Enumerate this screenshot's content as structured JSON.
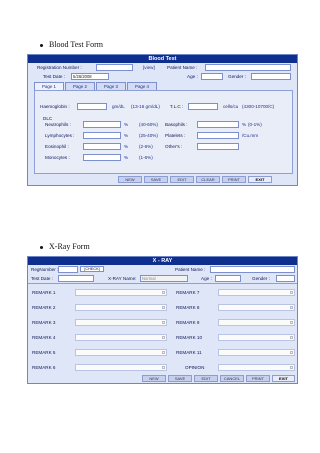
{
  "blood": {
    "heading": "Blood Test Form",
    "title": "Blood Test",
    "registration_label": "Registration Number :",
    "registration_value": "",
    "regno_button": "[view]",
    "patient_name_label": "Patient Name :",
    "patient_name_value": "",
    "test_date_label": "Test Date :",
    "test_date_value": "5/26/2008",
    "age_label": "Age :",
    "gender_label": "Gender :",
    "tabs": [
      "Page 1",
      "Page 2",
      "Page 3",
      "Page 4"
    ],
    "haemoglobin_label": "Haemoglobin :",
    "haemoglobin_unit": "gm/dL",
    "haemoglobin_range": "(13-16 gm/dL)",
    "tlc_label": "T.L.C :",
    "tlc_unit": "cells/cu",
    "tlc_range": "(4300-10700/C)",
    "dlc_label": "DLC",
    "neutrophils_label": "Neutrophils :",
    "neutrophils_unit": "%",
    "neutrophils_range": "(40-60%)",
    "lymphocytes_label": "Lymphocytes :",
    "lymphocytes_unit": "%",
    "lymphocytes_range": "(25-40%)",
    "eosinophil_label": "Eosinophil :",
    "eosinophil_unit": "%",
    "eosinophil_range": "(2-6%)",
    "monocytes_label": "Monocytes :",
    "monocytes_unit": "%",
    "monocytes_range": "(1-6%)",
    "basophils_label": "Basophils :",
    "basophils_unit": "%",
    "basophils_range": "(0-1%)",
    "platelets_label": "Platelets :",
    "platelets_unit": "/Cu.mm",
    "others_label": "Other's :",
    "buttons": [
      "NEW",
      "SAVE",
      "EDIT",
      "CLEAR",
      "PRINT",
      "EXIT"
    ]
  },
  "xray": {
    "heading": "X-Ray Form",
    "title": "X - RAY",
    "regnumber_label": "RegNumber :",
    "regnumber_button": "[CHECK]",
    "patient_name_label": "Patient Name :",
    "test_date_label": "Test Date :",
    "xray_name_label": "X-RAY Name:",
    "xray_name_value": "Normal",
    "age_label": "Age :",
    "gender_label": "Gender :",
    "remarks_left": [
      "REMARK 1",
      "REMARK 2",
      "REMARK 3",
      "REMARK 4",
      "REMARK 5",
      "REMARK 6"
    ],
    "remarks_right": [
      "REMARK 7",
      "REMARK 8",
      "REMARK 9",
      "REMARK 10",
      "REMARK 11",
      "OPINION"
    ],
    "buttons": [
      "NEW",
      "SAVE",
      "EDIT",
      "CANCEL",
      "PRINT",
      "EXIT"
    ]
  }
}
